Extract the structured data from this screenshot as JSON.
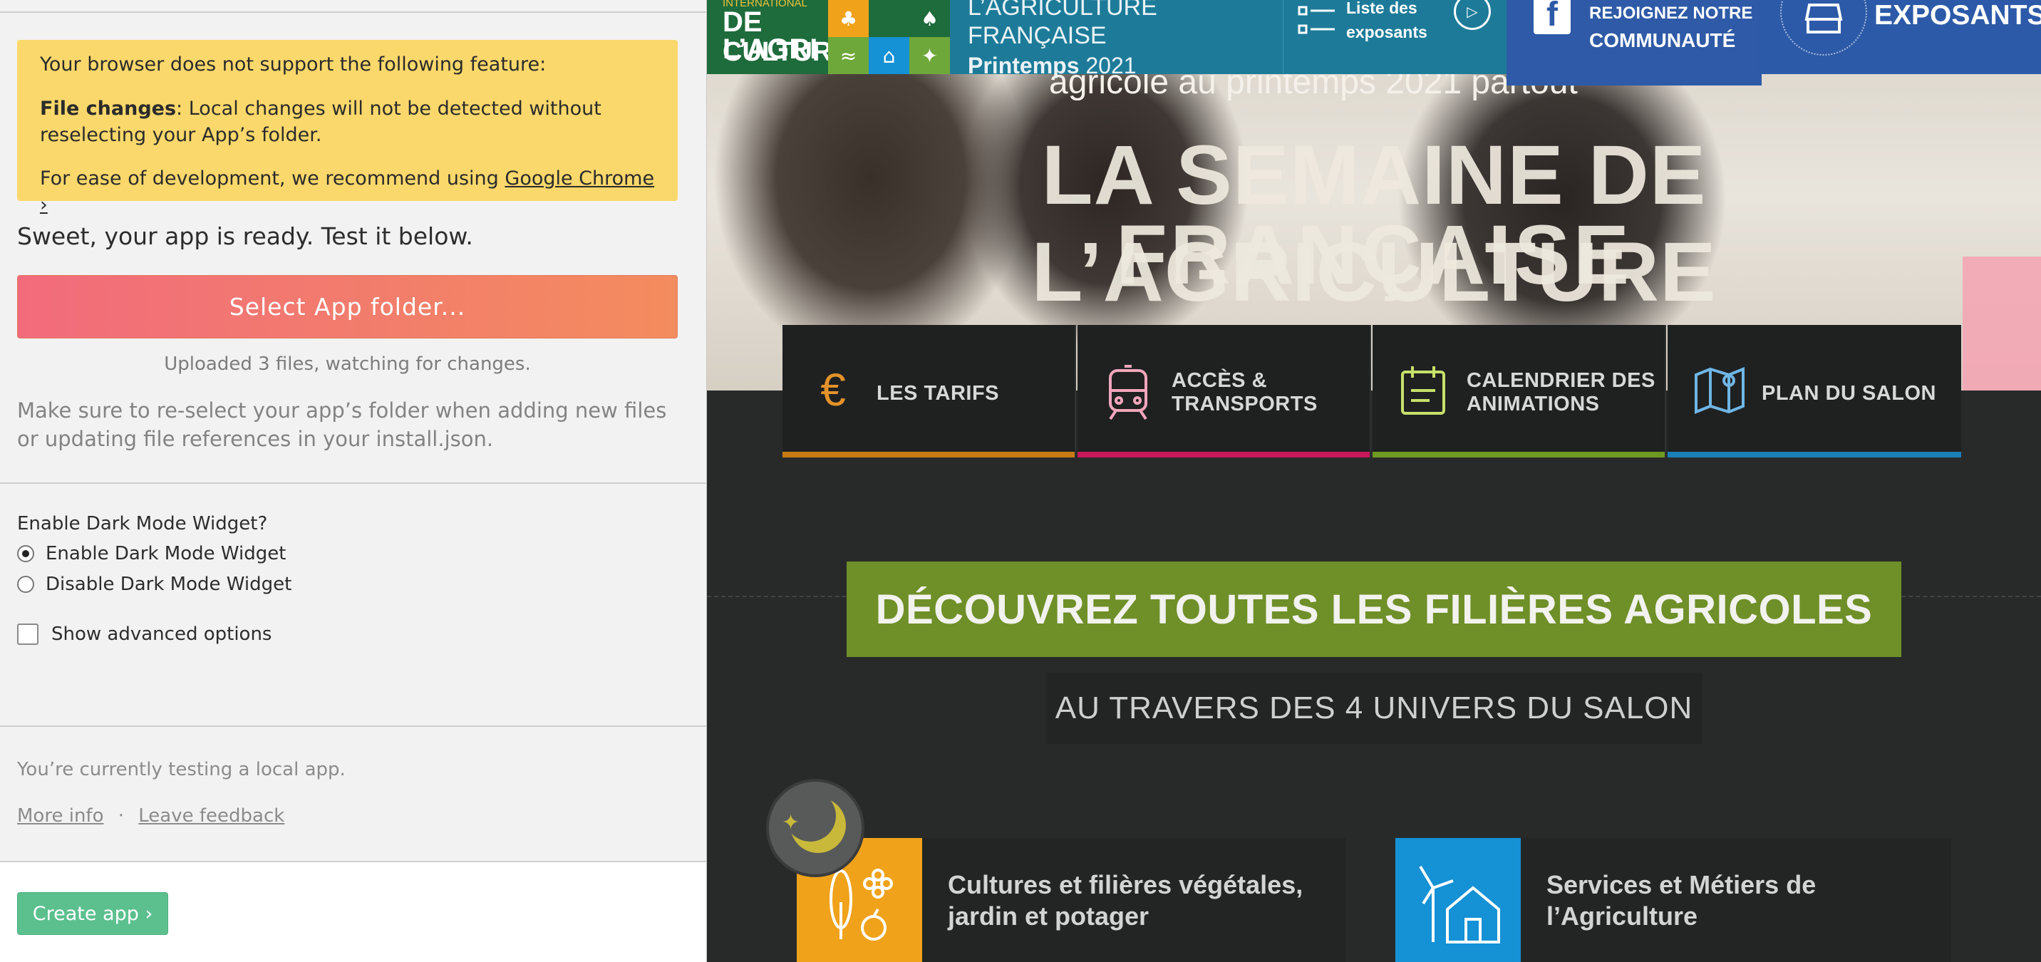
{
  "left": {
    "warning": {
      "intro": "Your browser does not support the following feature:",
      "feature_label": "File changes",
      "feature_text": ": Local changes will not be detected without reselecting your App’s folder.",
      "reco_text": "For ease of development, we recommend using ",
      "reco_link": "Google Chrome ›"
    },
    "ready_text": "Sweet, your app is ready. Test it below.",
    "select_button": "Select App folder...",
    "uploaded_text": "Uploaded 3 files, watching for changes.",
    "note_text": "Make sure to re-select your app’s folder when adding new files or updating file references in your install.json.",
    "dark_mode_question": "Enable Dark Mode Widget?",
    "options": [
      {
        "label": "Enable Dark Mode Widget",
        "selected": true
      },
      {
        "label": "Disable Dark Mode Widget",
        "selected": false
      }
    ],
    "advanced_label": "Show advanced options",
    "testing_text": "You’re currently testing a local app.",
    "more_info": "More info",
    "separator": "·",
    "leave_feedback": "Leave feedback",
    "create_button": "Create app ›"
  },
  "site": {
    "logo": {
      "top": "INTERNATIONAL",
      "line1": "DE L’AGRI",
      "line2": "CULTURE"
    },
    "brand": {
      "line1": "L’AGRICULTURE",
      "line2": "FRANÇAISE",
      "season": "Printemps",
      "year": "2021"
    },
    "nav_list": {
      "line1": "Liste des",
      "line2": "exposants"
    },
    "facebook": {
      "line1": "REJOIGNEZ NOTRE",
      "line2": "COMMUNAUTÉ"
    },
    "exposants": "EXPOSANTS",
    "hero": {
      "subtitle": "agricole au printemps 2021 partout",
      "title_line1": "LA SEMAINE DE L’AGRICULTURE",
      "title_line2": "FRANÇAISE"
    },
    "quick_links": [
      {
        "label": "LES TARIFS",
        "icon": "euro-icon",
        "color": "#e4922a"
      },
      {
        "label": "ACCÈS & TRANSPORTS",
        "icon": "train-icon",
        "color": "#c7185a"
      },
      {
        "label": "CALENDRIER DES ANIMATIONS",
        "icon": "calendar-icon",
        "color": "#7aa22e"
      },
      {
        "label": "PLAN DU SALON",
        "icon": "map-icon",
        "color": "#1b7fb8"
      }
    ],
    "banner": "DÉCOUVREZ TOUTES LES FILIÈRES AGRICOLES",
    "banner_sub": "AU TRAVERS DES 4 UNIVERS DU SALON",
    "universes": [
      {
        "title": "Cultures et filières végétales, jardin et potager",
        "color": "#f0a21a",
        "icon": "plant-icon"
      },
      {
        "title": "Services et Métiers de l’Agriculture",
        "color": "#1591d6",
        "icon": "wind-house-icon"
      }
    ],
    "dark_mode_widget": "moon-icon"
  }
}
